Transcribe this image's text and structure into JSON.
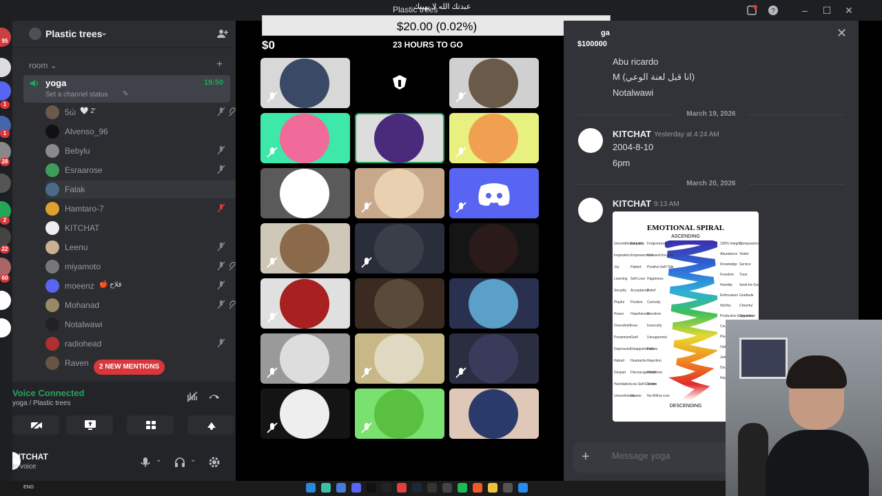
{
  "window": {
    "title": "Plastic trees",
    "arabic_overlay": "عبدتك الله لا يهينك"
  },
  "rail": {
    "badges": [
      "95",
      "1",
      "1",
      "28",
      "2",
      "22",
      "60"
    ]
  },
  "sidebar": {
    "guild_name": "Plastic trees",
    "category": "room",
    "voice_channel": {
      "name": "yoga",
      "time": "19:50",
      "status_placeholder": "Set a channel status"
    },
    "members": [
      {
        "name": "5ώ",
        "extra": "🤍 2'",
        "muted": true,
        "deafened": true,
        "color": "#6b5a4a"
      },
      {
        "name": "Alvenso_96",
        "extra": "",
        "muted": false,
        "deafened": false,
        "color": "#111111"
      },
      {
        "name": "Bebylu",
        "extra": "",
        "muted": true,
        "deafened": false,
        "color": "#8a8a8a"
      },
      {
        "name": "Esraarose",
        "extra": "",
        "muted": true,
        "deafened": false,
        "color": "#3f9c5a"
      },
      {
        "name": "Falak",
        "extra": "",
        "muted": false,
        "deafened": false,
        "color": "#4a6a88"
      },
      {
        "name": "Hamtaro-7",
        "extra": "",
        "muted": false,
        "deafened": false,
        "speaking_red": true,
        "color": "#e0a030"
      },
      {
        "name": "KITCHAT",
        "extra": "",
        "muted": false,
        "deafened": false,
        "color": "#eeeeee"
      },
      {
        "name": "Leenu",
        "extra": "",
        "muted": true,
        "deafened": false,
        "color": "#c8b090"
      },
      {
        "name": "miyamoto",
        "extra": "",
        "muted": true,
        "deafened": true,
        "color": "#777777"
      },
      {
        "name": "moeenz",
        "extra": "🍎 قلاح",
        "muted": true,
        "deafened": false,
        "color": "#5865f2"
      },
      {
        "name": "Mohanad",
        "extra": "",
        "muted": true,
        "deafened": true,
        "color": "#998866"
      },
      {
        "name": "Notalwawi",
        "extra": "",
        "muted": false,
        "deafened": false,
        "color": "#222222"
      },
      {
        "name": "radiohead",
        "extra": "",
        "muted": true,
        "deafened": false,
        "color": "#b03030"
      },
      {
        "name": "Raven",
        "extra": "",
        "muted": false,
        "deafened": false,
        "color": "#665544"
      }
    ],
    "mentions_pill": "2 NEW MENTIONS",
    "voice_panel": {
      "title": "Voice Connected",
      "subtitle": "yoga / Plastic trees"
    },
    "user": {
      "name": "KITCHAT",
      "status": "In voice"
    }
  },
  "stage": {
    "overlay_amount": "$20.00 (0.02%)",
    "balance": "$0",
    "countdown": "23 HOURS TO GO",
    "tiles": [
      {
        "bg": "#d8d8d8",
        "pic": "#3a4a66",
        "muted": true
      },
      {
        "bg": "#000000",
        "pic": "#000000",
        "muted": false,
        "logo": true
      },
      {
        "bg": "#d0d0d0",
        "pic": "#6a5a4a",
        "muted": true
      },
      {
        "bg": "#3ee8a8",
        "pic": "#f06a9a",
        "muted": true
      },
      {
        "bg": "#dddddd",
        "pic": "#4a2a7a",
        "muted": false,
        "active": true
      },
      {
        "bg": "#e8f080",
        "pic": "#f0a050",
        "muted": true
      },
      {
        "bg": "#5a5a5a",
        "pic": "#ffffff",
        "muted": false
      },
      {
        "bg": "#c8a88a",
        "pic": "#e8d0b0",
        "muted": true
      },
      {
        "bg": "#5865f2",
        "pic": "#5865f2",
        "muted": true,
        "discord": true
      },
      {
        "bg": "#cfc8b8",
        "pic": "#8a6a4a",
        "muted": true
      },
      {
        "bg": "#2a2e3a",
        "pic": "#3a3e48",
        "muted": true
      },
      {
        "bg": "#151515",
        "pic": "#2a1a1a",
        "muted": false
      },
      {
        "bg": "#e0e0e0",
        "pic": "#a82020",
        "muted": true
      },
      {
        "bg": "#3a2a22",
        "pic": "#5a4a3a",
        "muted": false
      },
      {
        "bg": "#2a3050",
        "pic": "#5aa0c8",
        "muted": false
      },
      {
        "bg": "#9a9a9a",
        "pic": "#dddddd",
        "muted": true
      },
      {
        "bg": "#c8b888",
        "pic": "#e0d8c0",
        "muted": true
      },
      {
        "bg": "#2a2e40",
        "pic": "#3a3a5a",
        "muted": true
      },
      {
        "bg": "#141414",
        "pic": "#eeeeee",
        "muted": true
      },
      {
        "bg": "#7ae070",
        "pic": "#5ac040",
        "muted": true
      },
      {
        "bg": "#e0c8b8",
        "pic": "#2a3a6a",
        "muted": false
      }
    ]
  },
  "chat": {
    "header_left_top": "ga",
    "header_left": "$100000",
    "top_lines": [
      "Abu ricardo",
      "M (انا قبل لعنة الوعي)",
      "Notalwawi"
    ],
    "messages": [
      {
        "date": "March 19, 2026",
        "author": "KITCHAT",
        "timestamp": "Yesterday at 4:24 AM",
        "lines": [
          "2004-8-10",
          "6pm"
        ]
      },
      {
        "date": "March 20, 2026",
        "author": "KITCHAT",
        "timestamp": "9:13 AM",
        "lines": []
      }
    ],
    "attachment": {
      "title": "EMOTIONAL SPIRAL",
      "top": "ASCENDING",
      "bottom": "DESCENDING",
      "left_words": [
        "Unconditional-Love",
        "Empathy",
        "Forgiveness",
        "Inspiration",
        "Empowerment",
        "Outward-focused",
        "Joy",
        "Patient",
        "Positive-Self-Talk",
        "Learning",
        "Self-Love",
        "Happiness",
        "Security",
        "Acceptance",
        "Belief",
        "Playful",
        "Positive",
        "Curiosity",
        "Peace",
        "Hopefulness",
        "Boredom",
        "Overwhelm",
        "Fear",
        "Insecurity",
        "Pessimism",
        "Grief",
        "Unsupported",
        "Depression",
        "Disappointment",
        "Failure",
        "Hatred",
        "Heartache",
        "Rejection",
        "Despair",
        "Discouragement",
        "Worthless",
        "Humiliation",
        "Low-Self-Esteem",
        "Victim",
        "Unworthiness",
        "Shame",
        "No-Will-to-Live"
      ],
      "right_words": [
        "100% Integrity",
        "Compassion",
        "Abundance",
        "Visitor",
        "Knowledge",
        "Service",
        "Freedom",
        "Trust",
        "Humility",
        "Seek-for-Good",
        "Enthusiasm",
        "Gratitude",
        "Worthy",
        "Cheerful",
        "Productive Expectation",
        "Organize",
        "Courage",
        "Serene",
        "Pleased",
        "Calm",
        "Optimism",
        "Jealousy",
        "Judgment",
        "Revenge",
        "Doubt",
        "Impatient",
        "Negative",
        "Blame"
      ]
    },
    "composer_placeholder": "Message yoga"
  },
  "taskbar": {
    "lang": "ENG"
  }
}
